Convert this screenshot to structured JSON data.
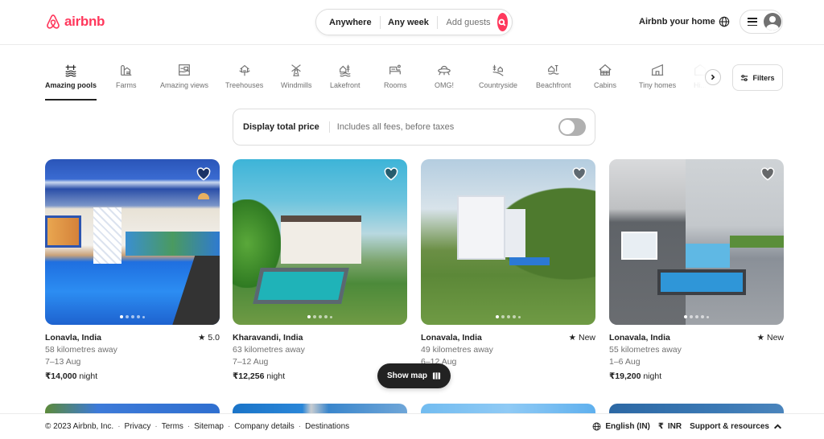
{
  "brand": {
    "name": "airbnb",
    "color": "#ff385c"
  },
  "search": {
    "where": "Anywhere",
    "when": "Any week",
    "guests_placeholder": "Add guests",
    "icon": "search-icon"
  },
  "header_right": {
    "host_link": "Airbnb your home",
    "language_icon": "globe-icon",
    "menu_icon": "hamburger-icon",
    "avatar_icon": "user-avatar-icon"
  },
  "categories": {
    "active_index": 0,
    "items": [
      {
        "label": "Amazing pools",
        "icon": "pool-icon"
      },
      {
        "label": "Farms",
        "icon": "farm-icon"
      },
      {
        "label": "Amazing views",
        "icon": "view-icon"
      },
      {
        "label": "Treehouses",
        "icon": "treehouse-icon"
      },
      {
        "label": "Windmills",
        "icon": "windmill-icon"
      },
      {
        "label": "Lakefront",
        "icon": "lakefront-icon"
      },
      {
        "label": "Rooms",
        "icon": "room-icon"
      },
      {
        "label": "OMG!",
        "icon": "ufo-icon"
      },
      {
        "label": "Countryside",
        "icon": "countryside-icon"
      },
      {
        "label": "Beachfront",
        "icon": "beachfront-icon"
      },
      {
        "label": "Cabins",
        "icon": "cabin-icon"
      },
      {
        "label": "Tiny homes",
        "icon": "tiny-home-icon"
      },
      {
        "label": "Hi..."
      }
    ],
    "filters_label": "Filters"
  },
  "total_price": {
    "title": "Display total price",
    "subtitle": "Includes all fees, before taxes",
    "enabled": false
  },
  "listings": [
    {
      "location": "Lonavla, India",
      "rating": "5.0",
      "distance": "58 kilometres away",
      "dates": "7–13 Aug",
      "price": "₹14,000",
      "price_unit": "night",
      "favorited": false,
      "photo_index": 1,
      "photo_count": 5
    },
    {
      "location": "Kharavandi, India",
      "rating": "",
      "distance": "63 kilometres away",
      "dates": "7–12 Aug",
      "price": "₹12,256",
      "price_unit": "night",
      "favorited": false,
      "photo_index": 1,
      "photo_count": 5
    },
    {
      "location": "Lonavala, India",
      "rating": "New",
      "distance": "49 kilometres away",
      "dates": "6–12 Aug",
      "price": "",
      "price_unit": "night",
      "favorited": false,
      "photo_index": 1,
      "photo_count": 5
    },
    {
      "location": "Lonavala, India",
      "rating": "New",
      "distance": "55 kilometres away",
      "dates": "1–6 Aug",
      "price": "₹19,200",
      "price_unit": "night",
      "favorited": false,
      "photo_index": 1,
      "photo_count": 5
    }
  ],
  "show_map": {
    "label": "Show map",
    "icon": "map-icon"
  },
  "footer": {
    "copyright": "© 2023 Airbnb, Inc.",
    "links": [
      "Privacy",
      "Terms",
      "Sitemap",
      "Company details",
      "Destinations"
    ],
    "language": "English (IN)",
    "currency_symbol": "₹",
    "currency": "INR",
    "support": "Support & resources"
  }
}
